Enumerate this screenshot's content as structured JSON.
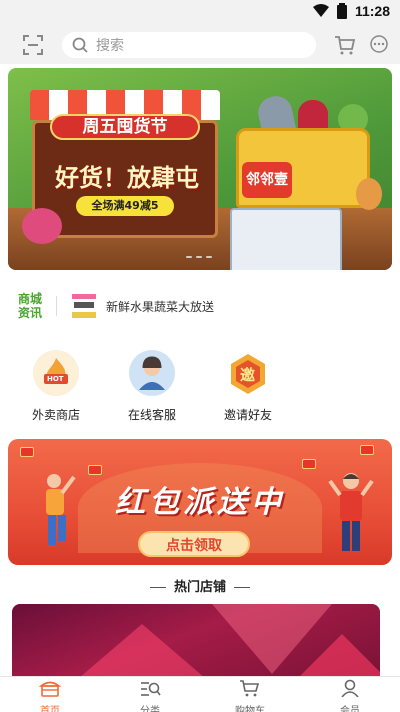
{
  "status_bar": {
    "time": "11:28"
  },
  "header": {
    "search_placeholder": "搜索"
  },
  "banner": {
    "headline": "周五囤货节",
    "slogan": "好货！放肆屯",
    "promo": "全场满49减5",
    "shop_sign": "邻邻壹"
  },
  "news": {
    "label_line1": "商城",
    "label_line2": "资讯",
    "text": "新鲜水果蔬菜大放送"
  },
  "quick_nav": [
    {
      "label": "外卖商店",
      "icon": "hot-flame-icon",
      "badge": "HOT"
    },
    {
      "label": "在线客服",
      "icon": "customer-service-icon"
    },
    {
      "label": "邀请好友",
      "icon": "invite-friend-icon",
      "badge": "邀"
    }
  ],
  "red_packet": {
    "title": "红包派送中",
    "button": "点击领取"
  },
  "section": {
    "hot_shops": "热门店铺"
  },
  "tabbar": [
    {
      "label": "首页",
      "icon": "home-icon",
      "active": true
    },
    {
      "label": "分类",
      "icon": "category-icon",
      "active": false
    },
    {
      "label": "购物车",
      "icon": "cart-icon",
      "active": false
    },
    {
      "label": "会员",
      "icon": "member-icon",
      "active": false
    }
  ],
  "colors": {
    "accent": "#ef6a36",
    "news_label": "#4aa52e",
    "header_bg": "#f2f2f2"
  }
}
